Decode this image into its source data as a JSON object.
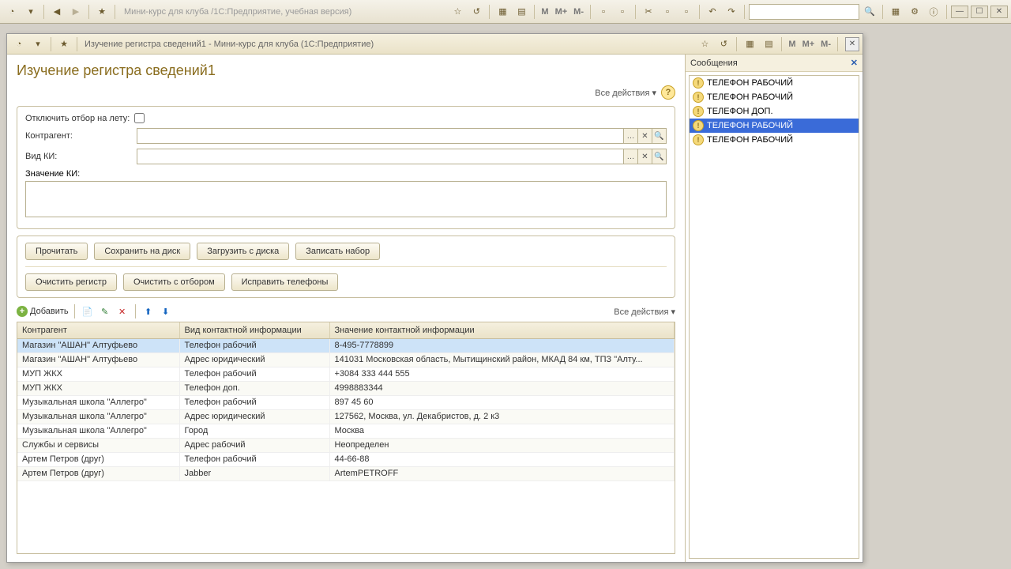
{
  "outer": {
    "title": "Мини-курс для клуба /1С:Предприятие, учебная версия)"
  },
  "window": {
    "title": "Изучение регистра сведений1 - Мини-курс для клуба  (1С:Предприятие)"
  },
  "page": {
    "title": "Изучение регистра сведений1",
    "all_actions": "Все действия ▾"
  },
  "form": {
    "disable_filter_label": "Отключить отбор на лету:",
    "kontragent_label": "Контрагент:",
    "vid_ki_label": "Вид КИ:",
    "value_ki_label": "Значение КИ:",
    "kontragent_value": "",
    "vid_ki_value": "",
    "value_ki_value": ""
  },
  "buttons": {
    "read": "Прочитать",
    "save_disk": "Сохранить на диск",
    "load_disk": "Загрузить с диска",
    "write_set": "Записать набор",
    "clear_register": "Очистить регистр",
    "clear_with_filter": "Очистить с отбором",
    "fix_phones": "Исправить телефоны"
  },
  "grid_toolbar": {
    "add": "Добавить",
    "all_actions": "Все действия ▾"
  },
  "grid": {
    "columns": [
      "Контрагент",
      "Вид контактной информации",
      "Значение контактной информации"
    ],
    "col_widths": [
      "205px",
      "190px",
      "auto"
    ],
    "rows": [
      [
        "Магазин \"АШАН\" Алтуфьево",
        "Телефон рабочий",
        "8-495-7778899"
      ],
      [
        "Магазин \"АШАН\" Алтуфьево",
        "Адрес юридический",
        "141031 Московская область, Мытищинский район, МКАД 84 км, ТПЗ \"Алту..."
      ],
      [
        "МУП ЖКХ",
        "Телефон рабочий",
        "+3084 333 444 555"
      ],
      [
        "МУП ЖКХ",
        "Телефон доп.",
        "4998883344"
      ],
      [
        "Музыкальная школа \"Аллегро\"",
        "Телефон рабочий",
        "897 45 60"
      ],
      [
        "Музыкальная школа \"Аллегро\"",
        "Адрес юридический",
        "127562, Москва, ул. Декабристов, д. 2 к3"
      ],
      [
        "Музыкальная школа \"Аллегро\"",
        "Город",
        "Москва"
      ],
      [
        "Службы и сервисы",
        "Адрес рабочий",
        "Неопределен"
      ],
      [
        "Артем Петров (друг)",
        "Телефон рабочий",
        "44-66-88"
      ],
      [
        "Артем Петров (друг)",
        "Jabber",
        "ArtemPETROFF"
      ]
    ],
    "selected": 0
  },
  "messages": {
    "header": "Сообщения",
    "items": [
      "ТЕЛЕФОН РАБОЧИЙ",
      "ТЕЛЕФОН РАБОЧИЙ",
      "ТЕЛЕФОН ДОП.",
      "ТЕЛЕФОН РАБОЧИЙ",
      "ТЕЛЕФОН РАБОЧИЙ"
    ],
    "selected": 3
  }
}
